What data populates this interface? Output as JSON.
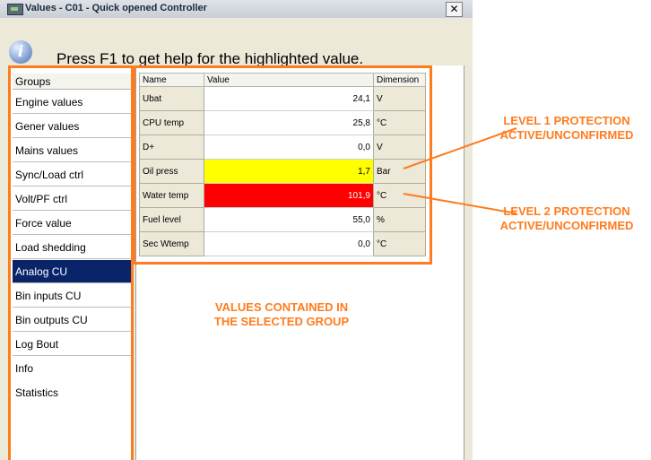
{
  "window": {
    "title": "Values - C01 - Quick opened Controller",
    "close_label": "✕"
  },
  "help": {
    "icon_glyph": "i",
    "text": "Press F1 to get help for the highlighted value."
  },
  "groups": {
    "header": "Groups",
    "items": [
      {
        "label": "Engine values",
        "selected": false
      },
      {
        "label": "Gener values",
        "selected": false
      },
      {
        "label": "Mains values",
        "selected": false
      },
      {
        "label": "Sync/Load ctrl",
        "selected": false
      },
      {
        "label": "Volt/PF ctrl",
        "selected": false
      },
      {
        "label": "Force value",
        "selected": false
      },
      {
        "label": "Load shedding",
        "selected": false
      },
      {
        "label": "Analog CU",
        "selected": true
      },
      {
        "label": "Bin inputs CU",
        "selected": false
      },
      {
        "label": "Bin outputs CU",
        "selected": false
      },
      {
        "label": "Log Bout",
        "selected": false
      },
      {
        "label": "Info",
        "selected": false
      },
      {
        "label": "Statistics",
        "selected": false
      }
    ]
  },
  "values_table": {
    "headers": {
      "name": "Name",
      "value": "Value",
      "dimension": "Dimension"
    },
    "rows": [
      {
        "name": "Ubat",
        "value": "24,1",
        "dimension": "V",
        "status": "normal"
      },
      {
        "name": "CPU temp",
        "value": "25,8",
        "dimension": "°C",
        "status": "normal"
      },
      {
        "name": "D+",
        "value": "0,0",
        "dimension": "V",
        "status": "normal"
      },
      {
        "name": "Oil press",
        "value": "1,7",
        "dimension": "Bar",
        "status": "level1"
      },
      {
        "name": "Water temp",
        "value": "101,9",
        "dimension": "°C",
        "status": "level2"
      },
      {
        "name": "Fuel level",
        "value": "55,0",
        "dimension": "%",
        "status": "normal"
      },
      {
        "name": "Sec Wtemp",
        "value": "0,0",
        "dimension": "°C",
        "status": "normal"
      }
    ]
  },
  "annotations": {
    "level1": [
      "LEVEL 1 PROTECTION",
      "ACTIVE/UNCONFIRMED"
    ],
    "level2": [
      "LEVEL 2 PROTECTION",
      "ACTIVE/UNCONFIRMED"
    ],
    "group": [
      "VALUES CONTAINED IN",
      "THE SELECTED GROUP"
    ]
  },
  "colors": {
    "highlight_frame": "#ff7c1e",
    "level1": "#ffff00",
    "level2": "#ff0000",
    "selection": "#0a246a"
  }
}
